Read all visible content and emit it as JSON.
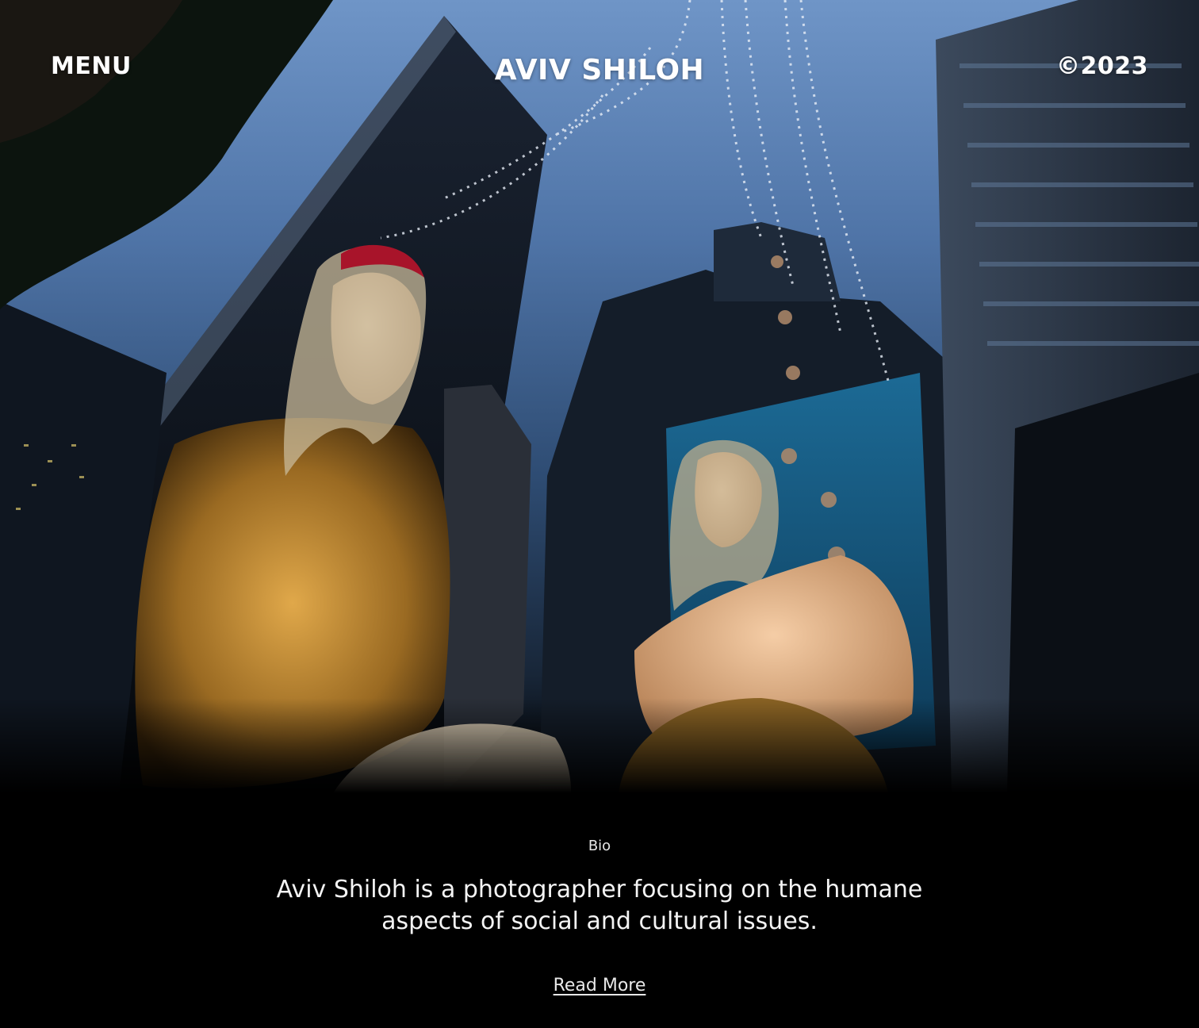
{
  "header": {
    "menu_label": "MENU",
    "brand": "AVIV SHILOH",
    "year": "©2023"
  },
  "hero": {
    "image_subject": "mannequins-in-shop-window-photo"
  },
  "bio": {
    "label": "Bio",
    "text": "Aviv Shiloh is a photographer focusing on the humane aspects of social and cultural issues.",
    "read_more": "Read More"
  },
  "colors": {
    "background": "#000000",
    "text": "#ffffff"
  }
}
